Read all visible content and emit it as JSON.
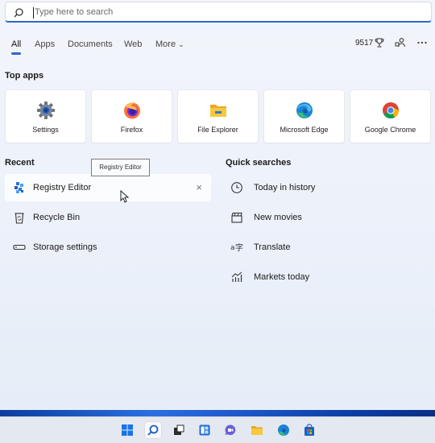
{
  "search": {
    "placeholder": "Type here to search"
  },
  "tabs": [
    "All",
    "Apps",
    "Documents",
    "Web",
    "More"
  ],
  "header": {
    "points": "9517"
  },
  "top_apps": {
    "title": "Top apps",
    "items": [
      {
        "label": "Settings",
        "icon": "settings-gear-icon"
      },
      {
        "label": "Firefox",
        "icon": "firefox-icon"
      },
      {
        "label": "File Explorer",
        "icon": "file-explorer-icon"
      },
      {
        "label": "Microsoft Edge",
        "icon": "edge-icon"
      },
      {
        "label": "Google Chrome",
        "icon": "chrome-icon"
      }
    ]
  },
  "recent": {
    "title": "Recent",
    "tooltip": "Registry Editor",
    "items": [
      {
        "label": "Registry Editor",
        "icon": "registry-editor-icon"
      },
      {
        "label": "Recycle Bin",
        "icon": "recycle-bin-icon"
      },
      {
        "label": "Storage settings",
        "icon": "storage-icon"
      }
    ],
    "close_glyph": "×"
  },
  "quick_searches": {
    "title": "Quick searches",
    "items": [
      {
        "label": "Today in history",
        "icon": "clock-icon"
      },
      {
        "label": "New movies",
        "icon": "clapperboard-icon"
      },
      {
        "label": "Translate",
        "icon": "translate-icon"
      },
      {
        "label": "Markets today",
        "icon": "chart-icon"
      }
    ]
  },
  "colors": {
    "accent": "#2f66c9",
    "taskbar": "#e3e8f1"
  }
}
